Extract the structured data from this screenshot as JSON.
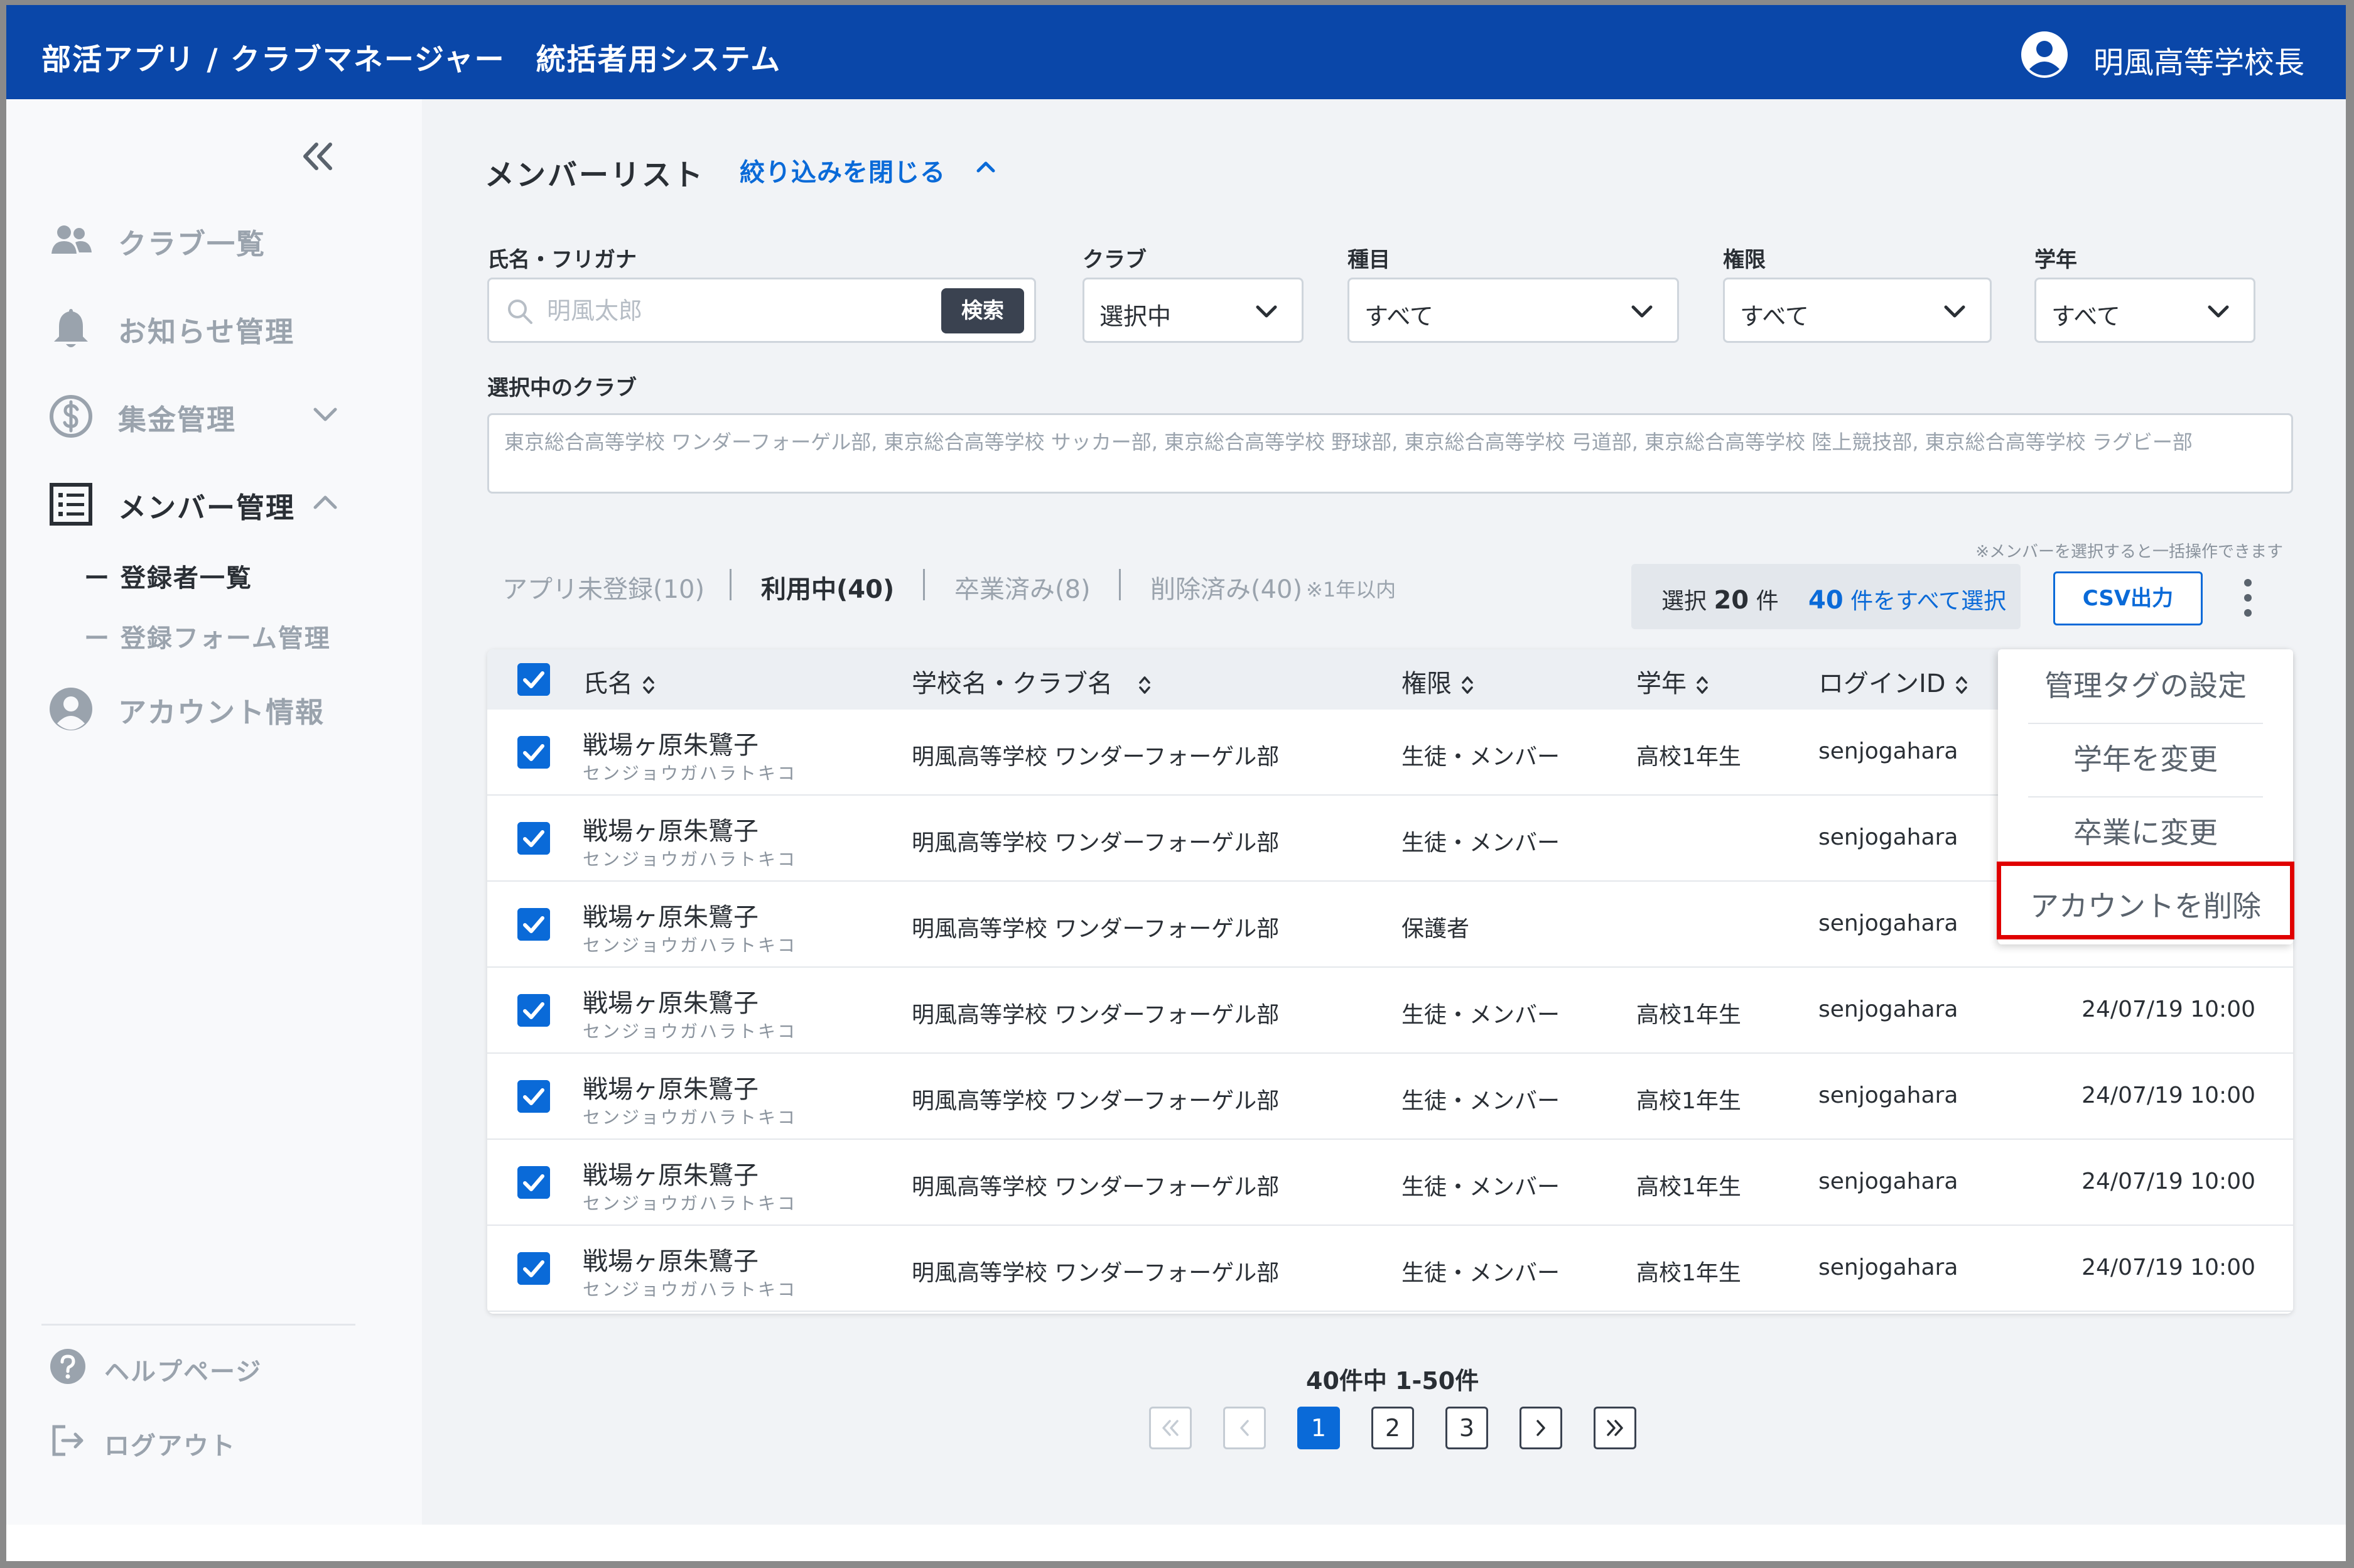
{
  "header": {
    "app_title": "部活アプリ / クラブマネージャー　統括者用システム",
    "user_name": "明風高等学校長"
  },
  "sidebar": {
    "items": [
      {
        "label": "クラブ一覧",
        "icon": "people-icon"
      },
      {
        "label": "お知らせ管理",
        "icon": "bell-icon"
      },
      {
        "label": "集金管理",
        "icon": "dollar-icon"
      },
      {
        "label": "メンバー管理",
        "icon": "list-icon"
      },
      {
        "label": "アカウント情報",
        "icon": "account-icon"
      }
    ],
    "sub_items": [
      "ー 登録者一覧",
      "ー 登録フォーム管理"
    ],
    "footer": [
      {
        "label": "ヘルプページ",
        "icon": "help-icon"
      },
      {
        "label": "ログアウト",
        "icon": "logout-icon"
      }
    ]
  },
  "main": {
    "title": "メンバーリスト",
    "filter_toggle": "絞り込みを閉じる",
    "filters": {
      "name_label": "氏名・フリガナ",
      "name_placeholder": "明風太郎",
      "search_button": "検索",
      "club_label": "クラブ",
      "club_value": "選択中",
      "type_label": "種目",
      "type_value": "すべて",
      "role_label": "権限",
      "role_value": "すべて",
      "grade_label": "学年",
      "grade_value": "すべて"
    },
    "selected_clubs_label": "選択中のクラブ",
    "selected_clubs_text": "東京総合高等学校 ワンダーフォーゲル部, 東京総合高等学校 サッカー部, 東京総合高等学校 野球部, 東京総合高等学校 弓道部, 東京総合高等学校 陸上競技部, 東京総合高等学校 ラグビー部",
    "bulk_hint": "※メンバーを選択すると一括操作できます",
    "tabs": [
      {
        "label": "アプリ未登録(10)"
      },
      {
        "label": "利用中(40)"
      },
      {
        "label": "卒業済み(8)"
      },
      {
        "label": "削除済み(40)"
      }
    ],
    "tab_note": "※1年以内",
    "selection": {
      "selected_prefix": "選択",
      "selected_count": "20",
      "selected_suffix": "件",
      "select_all_count": "40",
      "select_all_suffix": "件をすべて選択"
    },
    "csv_button": "CSV出力",
    "table": {
      "columns": [
        "氏名",
        "学校名・クラブ名",
        "権限",
        "学年",
        "ログインID"
      ],
      "rows": [
        {
          "name": "戦場ヶ原朱鷺子",
          "kana": "センジョウガハラトキコ",
          "club": "明風高等学校 ワンダーフォーゲル部",
          "role": "生徒・メンバー",
          "grade": "高校1年生",
          "login": "senjogahara",
          "date": ""
        },
        {
          "name": "戦場ヶ原朱鷺子",
          "kana": "センジョウガハラトキコ",
          "club": "明風高等学校 ワンダーフォーゲル部",
          "role": "生徒・メンバー",
          "grade": "",
          "login": "senjogahara",
          "date": ""
        },
        {
          "name": "戦場ヶ原朱鷺子",
          "kana": "センジョウガハラトキコ",
          "club": "明風高等学校 ワンダーフォーゲル部",
          "role": "保護者",
          "grade": "",
          "login": "senjogahara",
          "date": ""
        },
        {
          "name": "戦場ヶ原朱鷺子",
          "kana": "センジョウガハラトキコ",
          "club": "明風高等学校 ワンダーフォーゲル部",
          "role": "生徒・メンバー",
          "grade": "高校1年生",
          "login": "senjogahara",
          "date": "24/07/19 10:00"
        },
        {
          "name": "戦場ヶ原朱鷺子",
          "kana": "センジョウガハラトキコ",
          "club": "明風高等学校 ワンダーフォーゲル部",
          "role": "生徒・メンバー",
          "grade": "高校1年生",
          "login": "senjogahara",
          "date": "24/07/19 10:00"
        },
        {
          "name": "戦場ヶ原朱鷺子",
          "kana": "センジョウガハラトキコ",
          "club": "明風高等学校 ワンダーフォーゲル部",
          "role": "生徒・メンバー",
          "grade": "高校1年生",
          "login": "senjogahara",
          "date": "24/07/19 10:00"
        },
        {
          "name": "戦場ヶ原朱鷺子",
          "kana": "センジョウガハラトキコ",
          "club": "明風高等学校 ワンダーフォーゲル部",
          "role": "生徒・メンバー",
          "grade": "高校1年生",
          "login": "senjogahara",
          "date": "24/07/19 10:00"
        }
      ]
    },
    "menu": [
      "管理タグの設定",
      "学年を変更",
      "卒業に変更",
      "アカウントを削除"
    ],
    "pagination": {
      "summary": "40件中 1-50件",
      "pages": [
        "1",
        "2",
        "3"
      ],
      "current": "1"
    }
  },
  "colors": {
    "header_bg": "#0a47a9",
    "accent": "#0a6ad8",
    "highlight": "#e00000"
  }
}
